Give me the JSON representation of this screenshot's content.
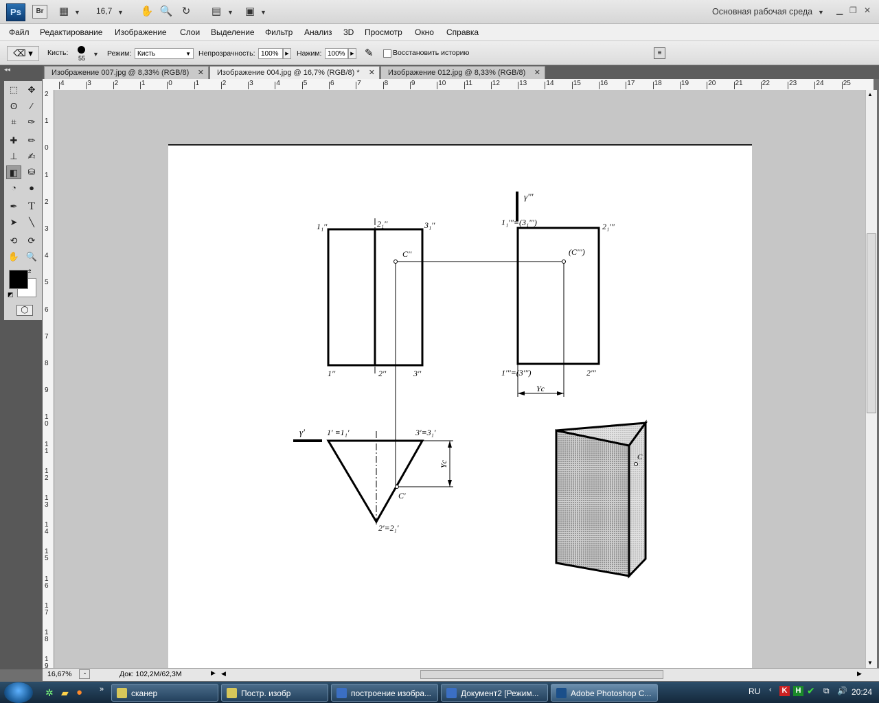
{
  "app": {
    "logo": "Ps",
    "bridge": "Br",
    "zoom_select": "16,7",
    "workspace": "Основная рабочая среда"
  },
  "menu": [
    "Файл",
    "Редактирование",
    "Изображение",
    "Слои",
    "Выделение",
    "Фильтр",
    "Анализ",
    "3D",
    "Просмотр",
    "Окно",
    "Справка"
  ],
  "options": {
    "brush_label": "Кисть:",
    "brush_size": "55",
    "mode_label": "Режим:",
    "mode_value": "Кисть",
    "opacity_label": "Непрозрачность:",
    "opacity_value": "100%",
    "flow_label": "Нажим:",
    "flow_value": "100%",
    "restore_history": "Восстановить историю"
  },
  "tabs": [
    {
      "label": "Изображение 007.jpg @ 8,33% (RGB/8)",
      "active": false
    },
    {
      "label": "Изображение 004.jpg @ 16,7% (RGB/8) *",
      "active": true
    },
    {
      "label": "Изображение 012.jpg @ 8,33% (RGB/8)",
      "active": false
    }
  ],
  "ruler_top": [
    "4",
    "3",
    "2",
    "1",
    "0",
    "1",
    "2",
    "3",
    "4",
    "5",
    "6",
    "7",
    "8",
    "9",
    "10",
    "11",
    "12",
    "13",
    "14",
    "15",
    "16",
    "17",
    "18",
    "19",
    "20",
    "21",
    "22",
    "23",
    "24",
    "25"
  ],
  "ruler_left": [
    "2",
    "1",
    "0",
    "1",
    "2",
    "3",
    "4",
    "5",
    "6",
    "7",
    "8",
    "9",
    "10",
    "11",
    "12",
    "13",
    "14",
    "15",
    "16",
    "17",
    "18",
    "19"
  ],
  "status": {
    "zoom": "16,67%",
    "doc": "Док: 102,2M/62,3M"
  },
  "drawing": {
    "gamma3": "γ'''",
    "gamma1": "γ'",
    "f11": "1₁''",
    "f21": "2₁''",
    "f31": "3₁''",
    "f1": "1''",
    "f2": "2''",
    "f3": "3''",
    "cpp": "C''",
    "p11": "1₁'''≡(3₁''')",
    "p21": "2₁'''",
    "pc": "(C''')",
    "p1": "1'''≡(3''')",
    "p2": "2'''",
    "yc": "Yc",
    "t1": "1' ≡1₁'",
    "t3": "3'≡3₁'",
    "t2": "2'≡2₁'",
    "tc": "C'",
    "iso_c": "C"
  },
  "taskbar": {
    "items": [
      {
        "label": "сканер",
        "active": false
      },
      {
        "label": "Постр. изобр",
        "active": false
      },
      {
        "label": "построение изобра...",
        "active": false
      },
      {
        "label": "Документ2 [Режим...",
        "active": false
      },
      {
        "label": "Adobe Photoshop C...",
        "active": true
      }
    ],
    "lang": "RU",
    "clock": "20:24"
  },
  "colors": {
    "foreground": "#000000",
    "background": "#ffffff",
    "canvas_bg": "#c6c6c6"
  }
}
